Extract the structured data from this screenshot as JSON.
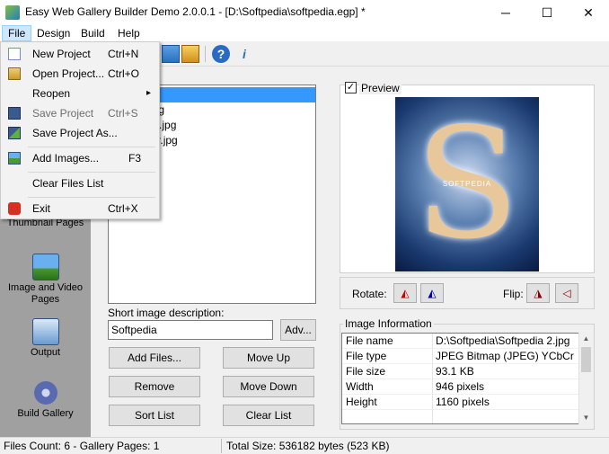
{
  "window": {
    "title": "Easy Web Gallery Builder Demo 2.0.0.1 - [D:\\Softpedia\\softpedia.egp] *",
    "minimize": "─",
    "maximize": "☐",
    "close": "✕"
  },
  "menubar": [
    "File",
    "Design",
    "Build",
    "Help"
  ],
  "file_menu": [
    {
      "label": "New Project",
      "shortcut": "Ctrl+N",
      "icon": "new-document-icon"
    },
    {
      "label": "Open Project...",
      "shortcut": "Ctrl+O",
      "icon": "open-folder-icon"
    },
    {
      "label": "Reopen",
      "shortcut": "",
      "arrow": "▸"
    },
    {
      "label": "Save Project",
      "shortcut": "Ctrl+S",
      "icon": "save-icon"
    },
    {
      "label": "Save Project As...",
      "shortcut": "",
      "icon": "save-as-icon"
    },
    {
      "label": "Add Images...",
      "shortcut": "F3",
      "icon": "add-images-icon"
    },
    {
      "label": "Clear Files List",
      "shortcut": ""
    },
    {
      "label": "Exit",
      "shortcut": "Ctrl+X",
      "icon": "exit-icon"
    }
  ],
  "sidebar": [
    {
      "label": "Thumbnail Pages"
    },
    {
      "label": "Image and Video Pages"
    },
    {
      "label": "Output"
    },
    {
      "label": "Build Gallery"
    }
  ],
  "files": [
    "dia 2.jpg",
    "dia test.jpg",
    "dia tested.jpg",
    "dia Winter.jpg",
    "dia.bmp",
    "dia.jpg"
  ],
  "short_desc_label": "Short image description:",
  "short_desc_value": "Softpedia",
  "adv_button": "Adv...",
  "buttons": {
    "add_files": "Add Files...",
    "move_up": "Move Up",
    "remove": "Remove",
    "move_down": "Move Down",
    "sort_list": "Sort List",
    "clear_list": "Clear List"
  },
  "preview": {
    "label": "Preview",
    "checked": "✓",
    "image_text": "SOFTPEDIA"
  },
  "rotate_label": "Rotate:",
  "flip_label": "Flip:",
  "info": {
    "group_label": "Image Information",
    "rows": [
      {
        "key": "File name",
        "value": "D:\\Softpedia\\Softpedia 2.jpg"
      },
      {
        "key": "File type",
        "value": "JPEG Bitmap (JPEG) YCbCr"
      },
      {
        "key": "File size",
        "value": "93.1 KB"
      },
      {
        "key": "Width",
        "value": "946 pixels"
      },
      {
        "key": "Height",
        "value": "1160 pixels"
      }
    ]
  },
  "status": {
    "left": "Files Count: 6 - Gallery Pages: 1",
    "right": "Total Size: 536182 bytes (523 KB)"
  },
  "colors": {
    "accent": "#3399ff",
    "menu_highlight": "#91c9f7",
    "sidebar": "#a0a0a0"
  }
}
